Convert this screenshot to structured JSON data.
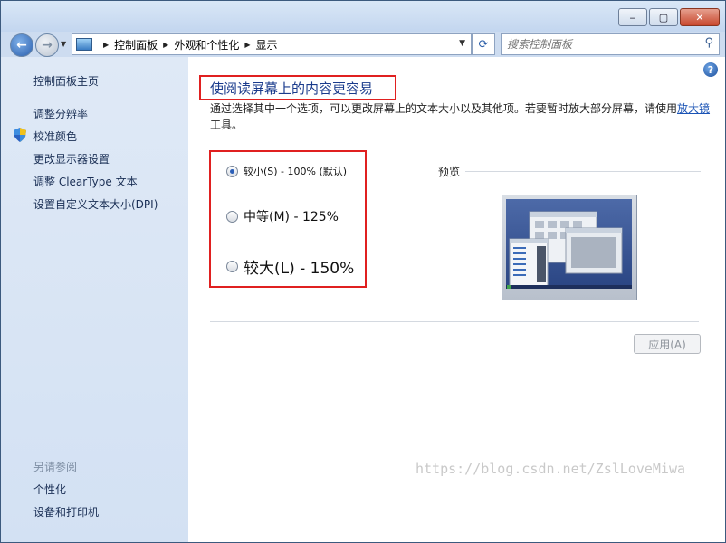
{
  "window": {
    "min_label": "‒",
    "max_label": "▢",
    "close_label": "✕"
  },
  "address": {
    "crumbs": [
      "控制面板",
      "外观和个性化",
      "显示"
    ],
    "search_placeholder": "搜索控制面板"
  },
  "sidebar": {
    "home": "控制面板主页",
    "links": [
      "调整分辨率",
      "校准颜色",
      "更改显示器设置",
      "调整 ClearType 文本",
      "设置自定义文本大小(DPI)"
    ],
    "see_also_title": "另请参阅",
    "see_also": [
      "个性化",
      "设备和打印机"
    ]
  },
  "main": {
    "title": "使阅读屏幕上的内容更容易",
    "desc_text": "通过选择其中一个选项，可以更改屏幕上的文本大小以及其他项。若要暂时放大部分屏幕，请使用",
    "desc_link": "放大镜",
    "desc_tail": "工具。",
    "options": [
      {
        "label": "较小(S) - 100% (默认)",
        "checked": true
      },
      {
        "label": "中等(M) - 125%",
        "checked": false
      },
      {
        "label": "较大(L) - 150%",
        "checked": false
      }
    ],
    "preview_label": "预览",
    "apply_label": "应用(A)"
  },
  "watermark": "https://blog.csdn.net/ZslLoveMiwa",
  "colors": {
    "accent": "#1a3b8c",
    "highlight_box": "#e02020"
  }
}
